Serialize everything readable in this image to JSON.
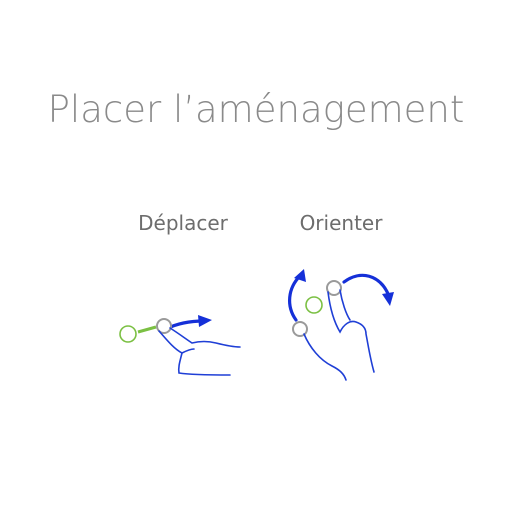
{
  "title": "Placer l’aménagement",
  "gestures": [
    {
      "label": "Déplacer",
      "icon": "drag-gesture-icon"
    },
    {
      "label": "Orienter",
      "icon": "rotate-gesture-icon"
    }
  ],
  "colors": {
    "title": "#8a8a8a",
    "label": "#6d6d6d",
    "hand_stroke": "#1f3fd6",
    "arrow": "#1530d8",
    "target_circle": "#7bc043",
    "touch_point": "#9a9a9a"
  }
}
